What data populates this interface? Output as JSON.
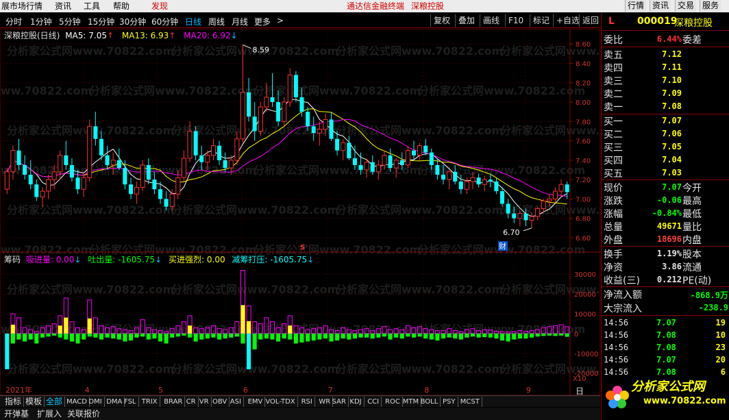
{
  "menu": {
    "items": [
      "展市场行情",
      "资讯",
      "工具",
      "帮助",
      "发现"
    ],
    "center_items": [
      "通达信金融终端",
      "深粮控股"
    ],
    "right_buttons": [
      "行情",
      "资讯",
      "交易",
      "服务"
    ]
  },
  "periods": [
    "分时",
    "1分钟",
    "5分钟",
    "15分钟",
    "30分钟",
    "60分钟",
    "日线",
    "周线",
    "月线",
    "更多",
    ">"
  ],
  "active_period": "日线",
  "toolbar": [
    "复权",
    "叠加",
    "画线",
    "F10",
    "标记",
    "+自选",
    "返回"
  ],
  "main_legend": {
    "name": "深粮控股(日线)",
    "ma5": "MA5: 7.05",
    "ma13": "MA13: 6.93",
    "ma20": "MA20: 6.92",
    "ma5_color": "#ffffff",
    "ma13_color": "#ffff00",
    "ma20_color": "#ff00ff"
  },
  "watermarks": [
    "分析家公式网www.70822.com",
    "公式网www.70822.com"
  ],
  "annotations": {
    "high": "8.59",
    "low": "6.70",
    "s_marker": "S",
    "cai_marker": "财"
  },
  "sub_legend": {
    "name": "筹码",
    "xijin": "吸进量: 0.00",
    "tuchu": "吐出量: -1605.75",
    "jinqiang": "买进强烈: 0.00",
    "jianchou": "减筹打压: -1605.75"
  },
  "chart_data": {
    "type": "candlestick",
    "price_axis": [
      "8.60",
      "8.40",
      "8.20",
      "8.00",
      "7.80",
      "7.60",
      "7.40",
      "7.20",
      "7.00",
      "6.80",
      "6.60"
    ],
    "volume_axis": [
      "30000",
      "20000",
      "10000",
      "0",
      "-10000",
      "-20000"
    ],
    "x_labels": [
      "2021年",
      "4",
      "5",
      "6",
      "7",
      "8",
      "9"
    ],
    "x10_label": "X10",
    "candles": [
      [
        7.1,
        7.32,
        7.05,
        7.28
      ],
      [
        7.28,
        7.55,
        7.2,
        7.5
      ],
      [
        7.5,
        7.62,
        7.3,
        7.35
      ],
      [
        7.35,
        7.45,
        7.2,
        7.25
      ],
      [
        7.25,
        7.4,
        7.1,
        7.15
      ],
      [
        7.15,
        7.2,
        6.98,
        7.02
      ],
      [
        7.02,
        7.12,
        6.92,
        7.08
      ],
      [
        7.08,
        7.25,
        7.0,
        7.2
      ],
      [
        7.2,
        7.35,
        7.1,
        7.28
      ],
      [
        7.28,
        7.5,
        7.2,
        7.45
      ],
      [
        7.45,
        7.6,
        7.3,
        7.35
      ],
      [
        7.35,
        7.42,
        7.18,
        7.22
      ],
      [
        7.22,
        7.3,
        7.05,
        7.1
      ],
      [
        7.1,
        7.28,
        7.02,
        7.22
      ],
      [
        7.22,
        7.82,
        7.18,
        7.75
      ],
      [
        7.75,
        7.9,
        7.55,
        7.62
      ],
      [
        7.62,
        7.7,
        7.4,
        7.45
      ],
      [
        7.45,
        7.55,
        7.3,
        7.35
      ],
      [
        7.35,
        7.48,
        7.25,
        7.4
      ],
      [
        7.4,
        7.52,
        7.3,
        7.32
      ],
      [
        7.32,
        7.4,
        7.1,
        7.15
      ],
      [
        7.15,
        7.22,
        7.0,
        7.05
      ],
      [
        7.05,
        7.18,
        6.95,
        7.12
      ],
      [
        7.12,
        7.4,
        7.08,
        7.35
      ],
      [
        7.35,
        7.42,
        7.15,
        7.2
      ],
      [
        7.2,
        7.28,
        7.05,
        7.1
      ],
      [
        7.1,
        7.18,
        6.95,
        7.0
      ],
      [
        7.0,
        7.08,
        6.88,
        6.92
      ],
      [
        6.92,
        7.1,
        6.88,
        7.05
      ],
      [
        7.05,
        7.3,
        7.0,
        7.22
      ],
      [
        7.22,
        7.5,
        7.18,
        7.42
      ],
      [
        7.42,
        7.8,
        7.38,
        7.7
      ],
      [
        7.7,
        7.75,
        7.4,
        7.45
      ],
      [
        7.45,
        7.55,
        7.3,
        7.38
      ],
      [
        7.38,
        7.5,
        7.3,
        7.45
      ],
      [
        7.45,
        7.62,
        7.4,
        7.55
      ],
      [
        7.55,
        7.6,
        7.35,
        7.4
      ],
      [
        7.4,
        7.48,
        7.28,
        7.32
      ],
      [
        7.32,
        7.45,
        7.25,
        7.4
      ],
      [
        7.4,
        7.7,
        7.35,
        7.62
      ],
      [
        7.62,
        8.59,
        7.58,
        8.1
      ],
      [
        8.1,
        8.25,
        7.8,
        7.85
      ],
      [
        7.85,
        8.0,
        7.6,
        7.7
      ],
      [
        7.7,
        8.0,
        7.65,
        7.95
      ],
      [
        7.95,
        8.2,
        7.9,
        8.05
      ],
      [
        8.05,
        8.3,
        7.95,
        8.0
      ],
      [
        8.0,
        8.12,
        7.75,
        7.8
      ],
      [
        7.8,
        8.05,
        7.75,
        8.0
      ],
      [
        8.0,
        8.35,
        7.95,
        8.28
      ],
      [
        8.28,
        8.32,
        8.0,
        8.05
      ],
      [
        8.05,
        8.15,
        7.85,
        7.9
      ],
      [
        7.9,
        7.95,
        7.7,
        7.75
      ],
      [
        7.75,
        7.85,
        7.6,
        7.68
      ],
      [
        7.68,
        7.8,
        7.55,
        7.72
      ],
      [
        7.72,
        7.88,
        7.65,
        7.82
      ],
      [
        7.82,
        7.9,
        7.6,
        7.62
      ],
      [
        7.62,
        7.7,
        7.45,
        7.5
      ],
      [
        7.5,
        7.62,
        7.4,
        7.58
      ],
      [
        7.58,
        7.65,
        7.4,
        7.42
      ],
      [
        7.42,
        7.55,
        7.3,
        7.35
      ],
      [
        7.35,
        7.48,
        7.25,
        7.3
      ],
      [
        7.3,
        7.42,
        7.22,
        7.38
      ],
      [
        7.38,
        7.45,
        7.25,
        7.28
      ],
      [
        7.28,
        7.4,
        7.2,
        7.35
      ],
      [
        7.35,
        7.5,
        7.3,
        7.45
      ],
      [
        7.45,
        7.52,
        7.28,
        7.32
      ],
      [
        7.32,
        7.42,
        7.22,
        7.4
      ],
      [
        7.4,
        7.48,
        7.3,
        7.35
      ],
      [
        7.35,
        7.55,
        7.32,
        7.5
      ],
      [
        7.5,
        7.6,
        7.4,
        7.45
      ],
      [
        7.45,
        7.58,
        7.4,
        7.55
      ],
      [
        7.55,
        7.62,
        7.45,
        7.48
      ],
      [
        7.48,
        7.52,
        7.3,
        7.35
      ],
      [
        7.35,
        7.42,
        7.2,
        7.25
      ],
      [
        7.25,
        7.35,
        7.15,
        7.2
      ],
      [
        7.2,
        7.3,
        7.1,
        7.28
      ],
      [
        7.28,
        7.35,
        7.15,
        7.18
      ],
      [
        7.18,
        7.25,
        7.05,
        7.1
      ],
      [
        7.1,
        7.22,
        7.05,
        7.18
      ],
      [
        7.18,
        7.28,
        7.1,
        7.22
      ],
      [
        7.22,
        7.26,
        7.12,
        7.15
      ],
      [
        7.15,
        7.24,
        7.08,
        7.2
      ],
      [
        7.2,
        7.26,
        7.12,
        7.18
      ],
      [
        7.18,
        7.22,
        7.05,
        7.08
      ],
      [
        7.08,
        7.12,
        6.92,
        6.95
      ],
      [
        6.95,
        7.0,
        6.8,
        6.85
      ],
      [
        6.85,
        6.92,
        6.75,
        6.8
      ],
      [
        6.8,
        6.88,
        6.72,
        6.85
      ],
      [
        6.85,
        6.9,
        6.72,
        6.78
      ],
      [
        6.78,
        6.86,
        6.7,
        6.82
      ],
      [
        6.82,
        6.92,
        6.78,
        6.9
      ],
      [
        6.9,
        7.0,
        6.85,
        6.98
      ],
      [
        6.98,
        7.05,
        6.92,
        7.0
      ],
      [
        7.0,
        7.12,
        6.96,
        7.08
      ],
      [
        7.08,
        7.2,
        7.02,
        7.15
      ],
      [
        7.15,
        7.18,
        7.0,
        7.07
      ]
    ],
    "volumes": [
      [
        0,
        -18000
      ],
      [
        10000,
        -5000
      ],
      [
        8000,
        -3000
      ],
      [
        3000,
        -4000
      ],
      [
        2000,
        -3000
      ],
      [
        1000,
        -5000
      ],
      [
        3000,
        -2000
      ],
      [
        4000,
        -1500
      ],
      [
        5000,
        -1000
      ],
      [
        9000,
        -2000
      ],
      [
        18000,
        -3000
      ],
      [
        6000,
        -4000
      ],
      [
        3000,
        -5000
      ],
      [
        2000,
        -3000
      ],
      [
        17000,
        -1500
      ],
      [
        8000,
        -2000
      ],
      [
        4000,
        -3000
      ],
      [
        3000,
        -2000
      ],
      [
        3500,
        -2500
      ],
      [
        2500,
        -3000
      ],
      [
        2000,
        -4000
      ],
      [
        1500,
        -3500
      ],
      [
        3000,
        -2000
      ],
      [
        7000,
        -1500
      ],
      [
        3000,
        -3000
      ],
      [
        2000,
        -2500
      ],
      [
        1500,
        -4000
      ],
      [
        1000,
        -5000
      ],
      [
        2500,
        -2000
      ],
      [
        4000,
        -1500
      ],
      [
        6000,
        -1000
      ],
      [
        9000,
        -2000
      ],
      [
        3000,
        -4000
      ],
      [
        2500,
        -3000
      ],
      [
        3000,
        -2500
      ],
      [
        4000,
        -2000
      ],
      [
        2500,
        -3000
      ],
      [
        2000,
        -2500
      ],
      [
        3000,
        -2000
      ],
      [
        6000,
        -1500
      ],
      [
        32000,
        -5000
      ],
      [
        14000,
        -18000
      ],
      [
        6000,
        -8000
      ],
      [
        5000,
        -3000
      ],
      [
        8000,
        -2500
      ],
      [
        6000,
        -3000
      ],
      [
        3000,
        -4000
      ],
      [
        5000,
        -2500
      ],
      [
        9000,
        -3000
      ],
      [
        4000,
        -5000
      ],
      [
        3000,
        -4500
      ],
      [
        2000,
        -4000
      ],
      [
        2500,
        -3500
      ],
      [
        3000,
        -3000
      ],
      [
        4000,
        -2500
      ],
      [
        2000,
        -4000
      ],
      [
        1500,
        -3500
      ],
      [
        3000,
        -2500
      ],
      [
        2000,
        -3000
      ],
      [
        1500,
        -2500
      ],
      [
        2000,
        -2000
      ],
      [
        2500,
        -2000
      ],
      [
        1500,
        -2500
      ],
      [
        2500,
        -2000
      ],
      [
        3500,
        -1500
      ],
      [
        2000,
        -3000
      ],
      [
        2500,
        -2000
      ],
      [
        2000,
        -2500
      ],
      [
        4000,
        -1500
      ],
      [
        3000,
        -2000
      ],
      [
        3500,
        -1500
      ],
      [
        2500,
        -2500
      ],
      [
        2000,
        -3000
      ],
      [
        1500,
        -3500
      ],
      [
        1500,
        -2500
      ],
      [
        2500,
        -2000
      ],
      [
        1500,
        -2500
      ],
      [
        1000,
        -3000
      ],
      [
        2000,
        -2000
      ],
      [
        2500,
        -1500
      ],
      [
        1500,
        -2000
      ],
      [
        2000,
        -1800
      ],
      [
        1800,
        -2000
      ],
      [
        1200,
        -2500
      ],
      [
        1000,
        -3500
      ],
      [
        800,
        -4000
      ],
      [
        1000,
        -3000
      ],
      [
        1500,
        -2500
      ],
      [
        1200,
        -2500
      ],
      [
        1500,
        -2000
      ],
      [
        2000,
        -1500
      ],
      [
        3000,
        -1200
      ],
      [
        3500,
        -1000
      ],
      [
        4000,
        -1200
      ],
      [
        4500,
        -1000
      ],
      [
        3500,
        -1605
      ]
    ]
  },
  "panel": {
    "header": {
      "letter": "L",
      "code": "000019",
      "name": "深粮控股"
    },
    "weibi": {
      "label": "委比",
      "value": "6.44%",
      "label2": "委差"
    },
    "asks": [
      {
        "label": "卖五",
        "price": "7.12"
      },
      {
        "label": "卖四",
        "price": "7.11"
      },
      {
        "label": "卖三",
        "price": "7.10"
      },
      {
        "label": "卖二",
        "price": "7.09"
      },
      {
        "label": "卖一",
        "price": "7.08"
      }
    ],
    "bids": [
      {
        "label": "买一",
        "price": "7.07"
      },
      {
        "label": "买二",
        "price": "7.06"
      },
      {
        "label": "买三",
        "price": "7.05"
      },
      {
        "label": "买四",
        "price": "7.04"
      },
      {
        "label": "买五",
        "price": "7.03"
      }
    ],
    "stats": [
      {
        "label": "现价",
        "value": "7.07",
        "label2": "今开",
        "color": "#00ff00"
      },
      {
        "label": "涨跌",
        "value": "-0.06",
        "label2": "最高",
        "color": "#00ff00"
      },
      {
        "label": "涨幅",
        "value": "-0.84%",
        "label2": "最低",
        "color": "#00ff00"
      },
      {
        "label": "总量",
        "value": "49671",
        "label2": "量比",
        "color": "#ffff00"
      },
      {
        "label": "外盘",
        "value": "18696",
        "label2": "内盘",
        "color": "#ff4040"
      }
    ],
    "stats2": [
      {
        "label": "换手",
        "value": "1.19%",
        "label2": "股本",
        "color": "#e6e6e6"
      },
      {
        "label": "净资",
        "value": "3.86",
        "label2": "流通",
        "color": "#e6e6e6"
      },
      {
        "label": "收益(三)",
        "value": "0.212",
        "label2": "PE(动)",
        "color": "#e6e6e6"
      }
    ],
    "flows": [
      {
        "label": "净流入额",
        "value": "-868.9万"
      },
      {
        "label": "大宗流入",
        "value": "-238.9"
      }
    ],
    "ticks": [
      {
        "time": "14:56",
        "price": "7.07",
        "vol": "19",
        "color": "#00ff00"
      },
      {
        "time": "14:56",
        "price": "7.08",
        "vol": "10",
        "color": "#00ff00"
      },
      {
        "time": "14:56",
        "price": "7.08",
        "vol": "23",
        "color": "#00ff00"
      },
      {
        "time": "14:56",
        "price": "7.07",
        "vol": "20",
        "color": "#00ff00"
      },
      {
        "time": "14:56",
        "price": "7.08",
        "vol": "6",
        "color": "#00ff00"
      }
    ],
    "logo_text": "分析家公式网",
    "logo_url": "www.70822.com",
    "side_letter": "日"
  },
  "tabs": [
    "指标",
    "模板",
    "全部",
    "MACD",
    "DMI",
    "DMA",
    "FSL",
    "TRIX",
    "BRAR",
    "CR",
    "VR",
    "OBV",
    "ASI",
    "EMV",
    "VOL-TDX",
    "RSI",
    "WR",
    "SAR",
    "KDJ",
    "CCI",
    "ROC",
    "MTM",
    "BOLL",
    "PSY",
    "MCST"
  ],
  "active_tab": "全部",
  "subtabs": [
    "开弹基",
    "扩展入",
    "关联报价"
  ]
}
